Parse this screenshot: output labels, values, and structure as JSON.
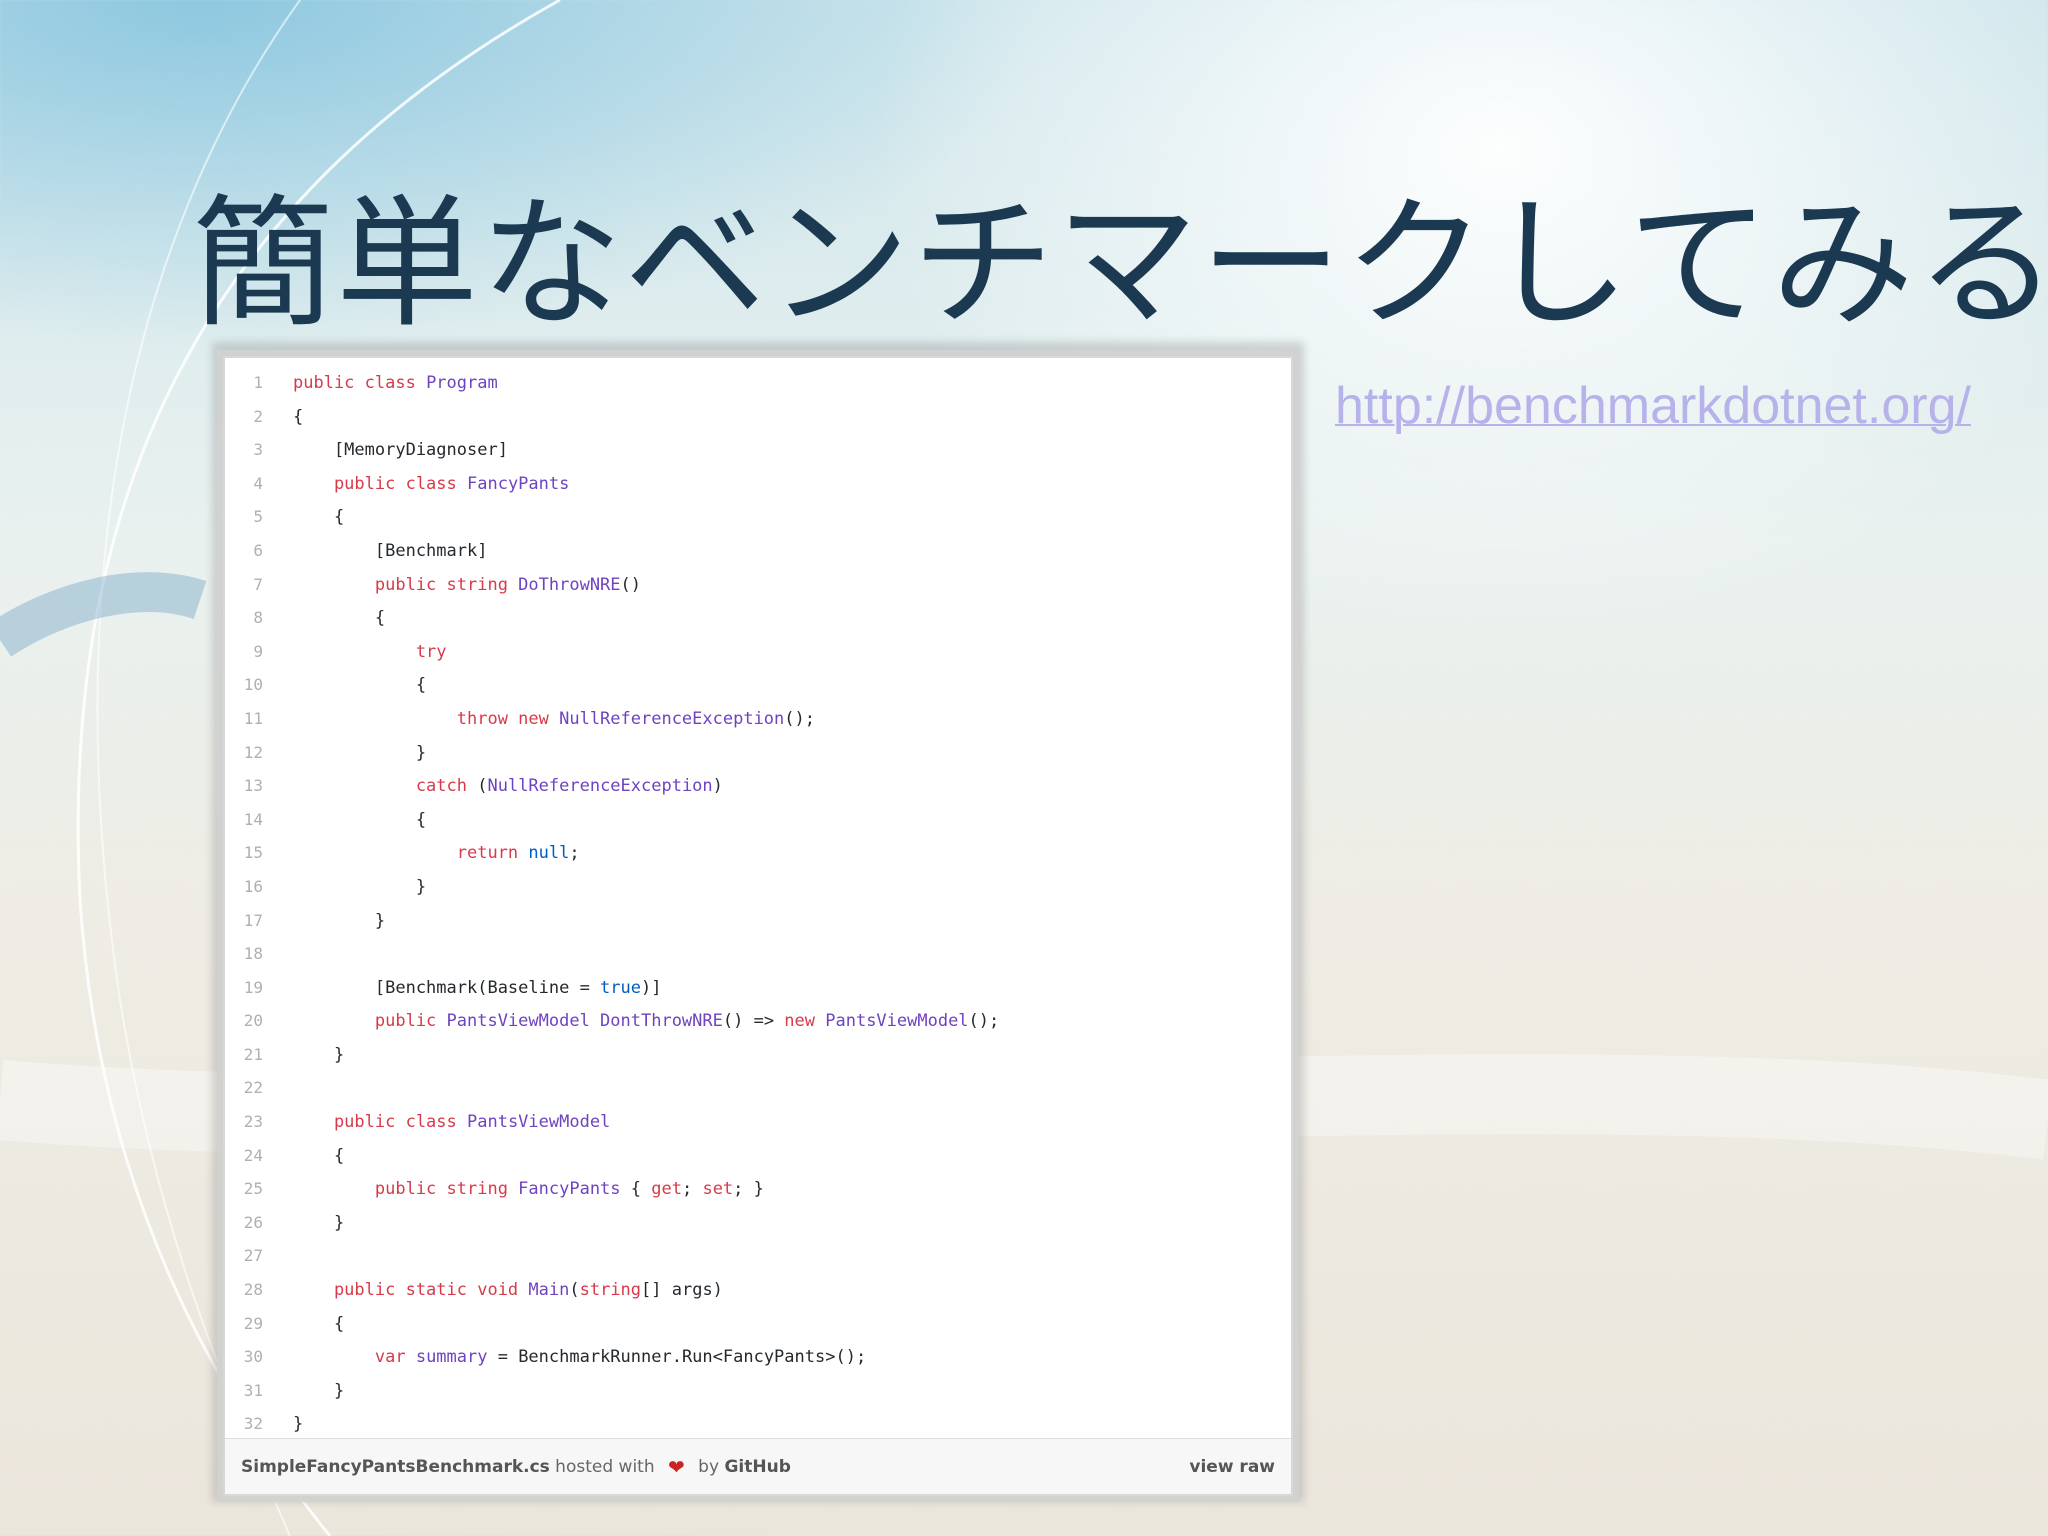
{
  "slide": {
    "title": "簡単なベンチマークしてみる",
    "link": "http://benchmarkdotnet.org/"
  },
  "gist": {
    "lines": [
      {
        "n": "1",
        "t": [
          [
            "kw",
            "public class "
          ],
          [
            "ty",
            "Program"
          ]
        ]
      },
      {
        "n": "2",
        "t": [
          [
            "p",
            "{"
          ]
        ]
      },
      {
        "n": "3",
        "t": [
          [
            "p",
            "    [MemoryDiagnoser]"
          ]
        ]
      },
      {
        "n": "4",
        "t": [
          [
            "kw",
            "    public class "
          ],
          [
            "ty",
            "FancyPants"
          ]
        ]
      },
      {
        "n": "5",
        "t": [
          [
            "p",
            "    {"
          ]
        ]
      },
      {
        "n": "6",
        "t": [
          [
            "p",
            "        [Benchmark]"
          ]
        ]
      },
      {
        "n": "7",
        "t": [
          [
            "kw",
            "        public string "
          ],
          [
            "ty",
            "DoThrowNRE"
          ],
          [
            "p",
            "()"
          ]
        ]
      },
      {
        "n": "8",
        "t": [
          [
            "p",
            "        {"
          ]
        ]
      },
      {
        "n": "9",
        "t": [
          [
            "kw",
            "            try"
          ]
        ]
      },
      {
        "n": "10",
        "t": [
          [
            "p",
            "            {"
          ]
        ]
      },
      {
        "n": "11",
        "t": [
          [
            "kw",
            "                throw new "
          ],
          [
            "ty",
            "NullReferenceException"
          ],
          [
            "p",
            "();"
          ]
        ]
      },
      {
        "n": "12",
        "t": [
          [
            "p",
            "            }"
          ]
        ]
      },
      {
        "n": "13",
        "t": [
          [
            "kw",
            "            catch "
          ],
          [
            "p",
            "("
          ],
          [
            "ty",
            "NullReferenceException"
          ],
          [
            "p",
            ")"
          ]
        ]
      },
      {
        "n": "14",
        "t": [
          [
            "p",
            "            {"
          ]
        ]
      },
      {
        "n": "15",
        "t": [
          [
            "kw",
            "                return "
          ],
          [
            "lit",
            "null"
          ],
          [
            "p",
            ";"
          ]
        ]
      },
      {
        "n": "16",
        "t": [
          [
            "p",
            "            }"
          ]
        ]
      },
      {
        "n": "17",
        "t": [
          [
            "p",
            "        }"
          ]
        ]
      },
      {
        "n": "18",
        "t": [
          [
            "p",
            ""
          ]
        ]
      },
      {
        "n": "19",
        "t": [
          [
            "p",
            "        [Benchmark(Baseline = "
          ],
          [
            "lit",
            "true"
          ],
          [
            "p",
            ")]"
          ]
        ]
      },
      {
        "n": "20",
        "t": [
          [
            "kw",
            "        public "
          ],
          [
            "ty",
            "PantsViewModel DontThrowNRE"
          ],
          [
            "p",
            "() => "
          ],
          [
            "kw",
            "new "
          ],
          [
            "ty",
            "PantsViewModel"
          ],
          [
            "p",
            "();"
          ]
        ]
      },
      {
        "n": "21",
        "t": [
          [
            "p",
            "    }"
          ]
        ]
      },
      {
        "n": "22",
        "t": [
          [
            "p",
            ""
          ]
        ]
      },
      {
        "n": "23",
        "t": [
          [
            "kw",
            "    public class "
          ],
          [
            "ty",
            "PantsViewModel"
          ]
        ]
      },
      {
        "n": "24",
        "t": [
          [
            "p",
            "    {"
          ]
        ]
      },
      {
        "n": "25",
        "t": [
          [
            "kw",
            "        public string "
          ],
          [
            "ty",
            "FancyPants"
          ],
          [
            "p",
            " { "
          ],
          [
            "kw",
            "get"
          ],
          [
            "p",
            "; "
          ],
          [
            "kw",
            "set"
          ],
          [
            "p",
            "; }"
          ]
        ]
      },
      {
        "n": "26",
        "t": [
          [
            "p",
            "    }"
          ]
        ]
      },
      {
        "n": "27",
        "t": [
          [
            "p",
            ""
          ]
        ]
      },
      {
        "n": "28",
        "t": [
          [
            "kw",
            "    public static void "
          ],
          [
            "ty",
            "Main"
          ],
          [
            "p",
            "("
          ],
          [
            "kw",
            "string"
          ],
          [
            "p",
            "[] args)"
          ]
        ]
      },
      {
        "n": "29",
        "t": [
          [
            "p",
            "    {"
          ]
        ]
      },
      {
        "n": "30",
        "t": [
          [
            "kw",
            "        var "
          ],
          [
            "ty",
            "summary"
          ],
          [
            "p",
            " = BenchmarkRunner.Run<FancyPants>();"
          ]
        ]
      },
      {
        "n": "31",
        "t": [
          [
            "p",
            "    }"
          ]
        ]
      },
      {
        "n": "32",
        "t": [
          [
            "p",
            "}"
          ]
        ]
      }
    ],
    "footer": {
      "filename": "SimpleFancyPantsBenchmark.cs",
      "hosted_with": " hosted with ",
      "heart": "❤",
      "by": " by ",
      "github": "GitHub",
      "view_raw": "view raw"
    }
  }
}
